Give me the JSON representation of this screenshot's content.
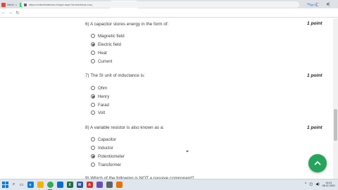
{
  "browser": {
    "tabs": [
      {
        "label": "Nitesh",
        "fav": "#ea4335"
      },
      {
        "label": "WhatsApp",
        "fav": "#25d366"
      },
      {
        "label": "Resistance",
        "fav": "#ea4335"
      },
      {
        "label": "(3) What",
        "fav": "#25d366"
      },
      {
        "label": "Instagram",
        "fav": "#c13584"
      },
      {
        "label": "Electrical",
        "fav": "#ea4335"
      },
      {
        "label": "Electrical",
        "fav": "#202124",
        "active": true
      },
      {
        "label": "NPTEL",
        "fav": "#ea4335"
      },
      {
        "label": "MSEDCL",
        "fav": "#ea4335"
      },
      {
        "label": "Gmail",
        "fav": "#ea4335"
      },
      {
        "label": "Google",
        "fav": "#4285f4"
      }
    ],
    "url": "https://onlinetestseries.in/quiz.aspx?id=electrical-mcq",
    "signin_label": "Sign in"
  },
  "questions": [
    {
      "title": "6)  A capacitor stores energy in the form of:",
      "points": "1 point",
      "options": [
        {
          "label": "Magnetic field",
          "checked": false
        },
        {
          "label": "Electric field",
          "checked": true
        },
        {
          "label": "Heat",
          "checked": false
        },
        {
          "label": "Current",
          "checked": false
        }
      ]
    },
    {
      "title": "7)  The SI unit of inductance is:",
      "points": "1 point",
      "options": [
        {
          "label": "Ohm",
          "checked": false
        },
        {
          "label": "Henry",
          "checked": true
        },
        {
          "label": "Farad",
          "checked": false
        },
        {
          "label": "Volt",
          "checked": false
        }
      ]
    },
    {
      "title": "8)  A variable resistor is also known as a:",
      "points": "1 point",
      "options": [
        {
          "label": "Capacitor",
          "checked": false
        },
        {
          "label": "Inductor",
          "checked": false
        },
        {
          "label": "Potentiometer",
          "checked": true
        },
        {
          "label": "Transformer",
          "checked": false
        }
      ]
    },
    {
      "title": "9)  Which of the following is NOT a passive component?",
      "points": "",
      "options": []
    }
  ],
  "taskbar": {
    "apps": [
      {
        "name": "edge",
        "color": "#0f7bd4",
        "glyph": "e"
      },
      {
        "name": "file-explorer",
        "color": "#f3b400",
        "glyph": ""
      },
      {
        "name": "chrome",
        "color": "#34a853",
        "glyph": ""
      },
      {
        "name": "store",
        "color": "#0a6ed1",
        "glyph": ""
      },
      {
        "name": "excel",
        "color": "#1d6f42",
        "glyph": "X"
      },
      {
        "name": "word",
        "color": "#2b579a",
        "glyph": "W"
      },
      {
        "name": "acrobat",
        "color": "#d93025",
        "glyph": "A"
      },
      {
        "name": "photos",
        "color": "#6b4fbb",
        "glyph": ""
      },
      {
        "name": "settings",
        "color": "#5f6368",
        "glyph": ""
      },
      {
        "name": "media",
        "color": "#e8710a",
        "glyph": ""
      }
    ],
    "time": "14:41",
    "date": "06-07-2021"
  },
  "colors": {
    "fab": "#25a45c",
    "radio": "#5f6368"
  }
}
